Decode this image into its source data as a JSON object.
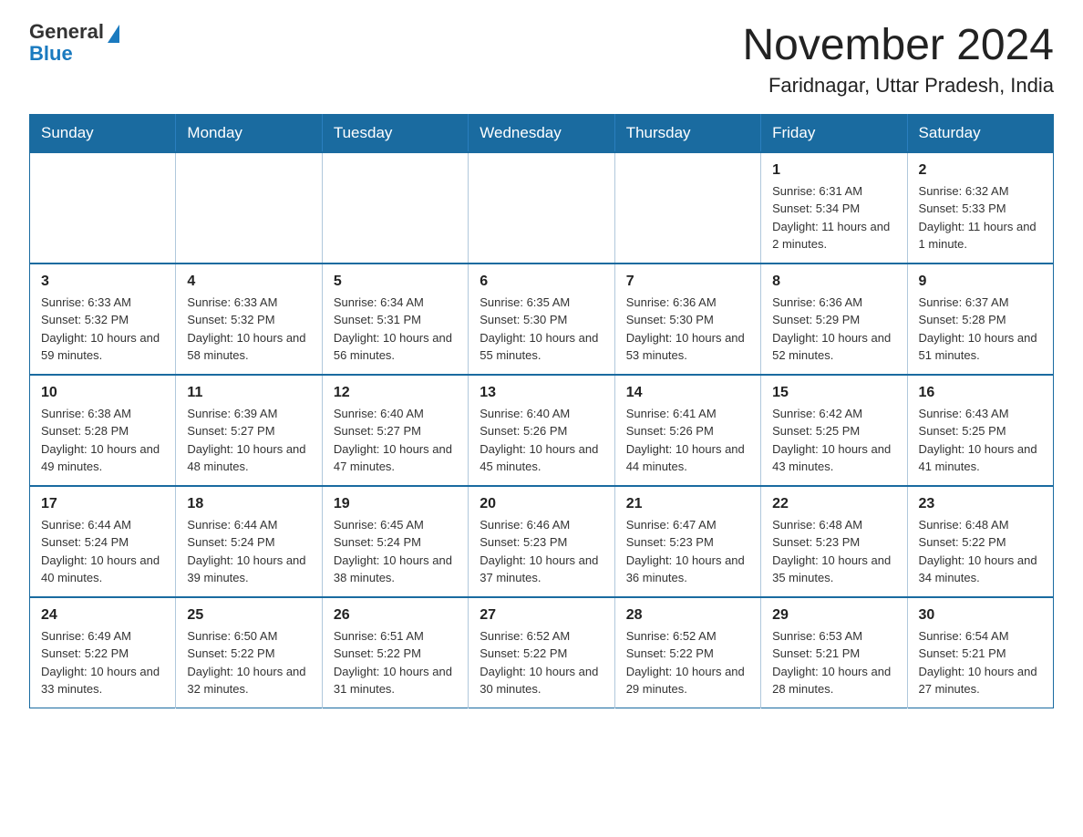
{
  "logo": {
    "general": "General",
    "blue": "Blue"
  },
  "title": "November 2024",
  "subtitle": "Faridnagar, Uttar Pradesh, India",
  "days_of_week": [
    "Sunday",
    "Monday",
    "Tuesday",
    "Wednesday",
    "Thursday",
    "Friday",
    "Saturday"
  ],
  "weeks": [
    [
      {
        "day": "",
        "info": ""
      },
      {
        "day": "",
        "info": ""
      },
      {
        "day": "",
        "info": ""
      },
      {
        "day": "",
        "info": ""
      },
      {
        "day": "",
        "info": ""
      },
      {
        "day": "1",
        "info": "Sunrise: 6:31 AM\nSunset: 5:34 PM\nDaylight: 11 hours and 2 minutes."
      },
      {
        "day": "2",
        "info": "Sunrise: 6:32 AM\nSunset: 5:33 PM\nDaylight: 11 hours and 1 minute."
      }
    ],
    [
      {
        "day": "3",
        "info": "Sunrise: 6:33 AM\nSunset: 5:32 PM\nDaylight: 10 hours and 59 minutes."
      },
      {
        "day": "4",
        "info": "Sunrise: 6:33 AM\nSunset: 5:32 PM\nDaylight: 10 hours and 58 minutes."
      },
      {
        "day": "5",
        "info": "Sunrise: 6:34 AM\nSunset: 5:31 PM\nDaylight: 10 hours and 56 minutes."
      },
      {
        "day": "6",
        "info": "Sunrise: 6:35 AM\nSunset: 5:30 PM\nDaylight: 10 hours and 55 minutes."
      },
      {
        "day": "7",
        "info": "Sunrise: 6:36 AM\nSunset: 5:30 PM\nDaylight: 10 hours and 53 minutes."
      },
      {
        "day": "8",
        "info": "Sunrise: 6:36 AM\nSunset: 5:29 PM\nDaylight: 10 hours and 52 minutes."
      },
      {
        "day": "9",
        "info": "Sunrise: 6:37 AM\nSunset: 5:28 PM\nDaylight: 10 hours and 51 minutes."
      }
    ],
    [
      {
        "day": "10",
        "info": "Sunrise: 6:38 AM\nSunset: 5:28 PM\nDaylight: 10 hours and 49 minutes."
      },
      {
        "day": "11",
        "info": "Sunrise: 6:39 AM\nSunset: 5:27 PM\nDaylight: 10 hours and 48 minutes."
      },
      {
        "day": "12",
        "info": "Sunrise: 6:40 AM\nSunset: 5:27 PM\nDaylight: 10 hours and 47 minutes."
      },
      {
        "day": "13",
        "info": "Sunrise: 6:40 AM\nSunset: 5:26 PM\nDaylight: 10 hours and 45 minutes."
      },
      {
        "day": "14",
        "info": "Sunrise: 6:41 AM\nSunset: 5:26 PM\nDaylight: 10 hours and 44 minutes."
      },
      {
        "day": "15",
        "info": "Sunrise: 6:42 AM\nSunset: 5:25 PM\nDaylight: 10 hours and 43 minutes."
      },
      {
        "day": "16",
        "info": "Sunrise: 6:43 AM\nSunset: 5:25 PM\nDaylight: 10 hours and 41 minutes."
      }
    ],
    [
      {
        "day": "17",
        "info": "Sunrise: 6:44 AM\nSunset: 5:24 PM\nDaylight: 10 hours and 40 minutes."
      },
      {
        "day": "18",
        "info": "Sunrise: 6:44 AM\nSunset: 5:24 PM\nDaylight: 10 hours and 39 minutes."
      },
      {
        "day": "19",
        "info": "Sunrise: 6:45 AM\nSunset: 5:24 PM\nDaylight: 10 hours and 38 minutes."
      },
      {
        "day": "20",
        "info": "Sunrise: 6:46 AM\nSunset: 5:23 PM\nDaylight: 10 hours and 37 minutes."
      },
      {
        "day": "21",
        "info": "Sunrise: 6:47 AM\nSunset: 5:23 PM\nDaylight: 10 hours and 36 minutes."
      },
      {
        "day": "22",
        "info": "Sunrise: 6:48 AM\nSunset: 5:23 PM\nDaylight: 10 hours and 35 minutes."
      },
      {
        "day": "23",
        "info": "Sunrise: 6:48 AM\nSunset: 5:22 PM\nDaylight: 10 hours and 34 minutes."
      }
    ],
    [
      {
        "day": "24",
        "info": "Sunrise: 6:49 AM\nSunset: 5:22 PM\nDaylight: 10 hours and 33 minutes."
      },
      {
        "day": "25",
        "info": "Sunrise: 6:50 AM\nSunset: 5:22 PM\nDaylight: 10 hours and 32 minutes."
      },
      {
        "day": "26",
        "info": "Sunrise: 6:51 AM\nSunset: 5:22 PM\nDaylight: 10 hours and 31 minutes."
      },
      {
        "day": "27",
        "info": "Sunrise: 6:52 AM\nSunset: 5:22 PM\nDaylight: 10 hours and 30 minutes."
      },
      {
        "day": "28",
        "info": "Sunrise: 6:52 AM\nSunset: 5:22 PM\nDaylight: 10 hours and 29 minutes."
      },
      {
        "day": "29",
        "info": "Sunrise: 6:53 AM\nSunset: 5:21 PM\nDaylight: 10 hours and 28 minutes."
      },
      {
        "day": "30",
        "info": "Sunrise: 6:54 AM\nSunset: 5:21 PM\nDaylight: 10 hours and 27 minutes."
      }
    ]
  ]
}
